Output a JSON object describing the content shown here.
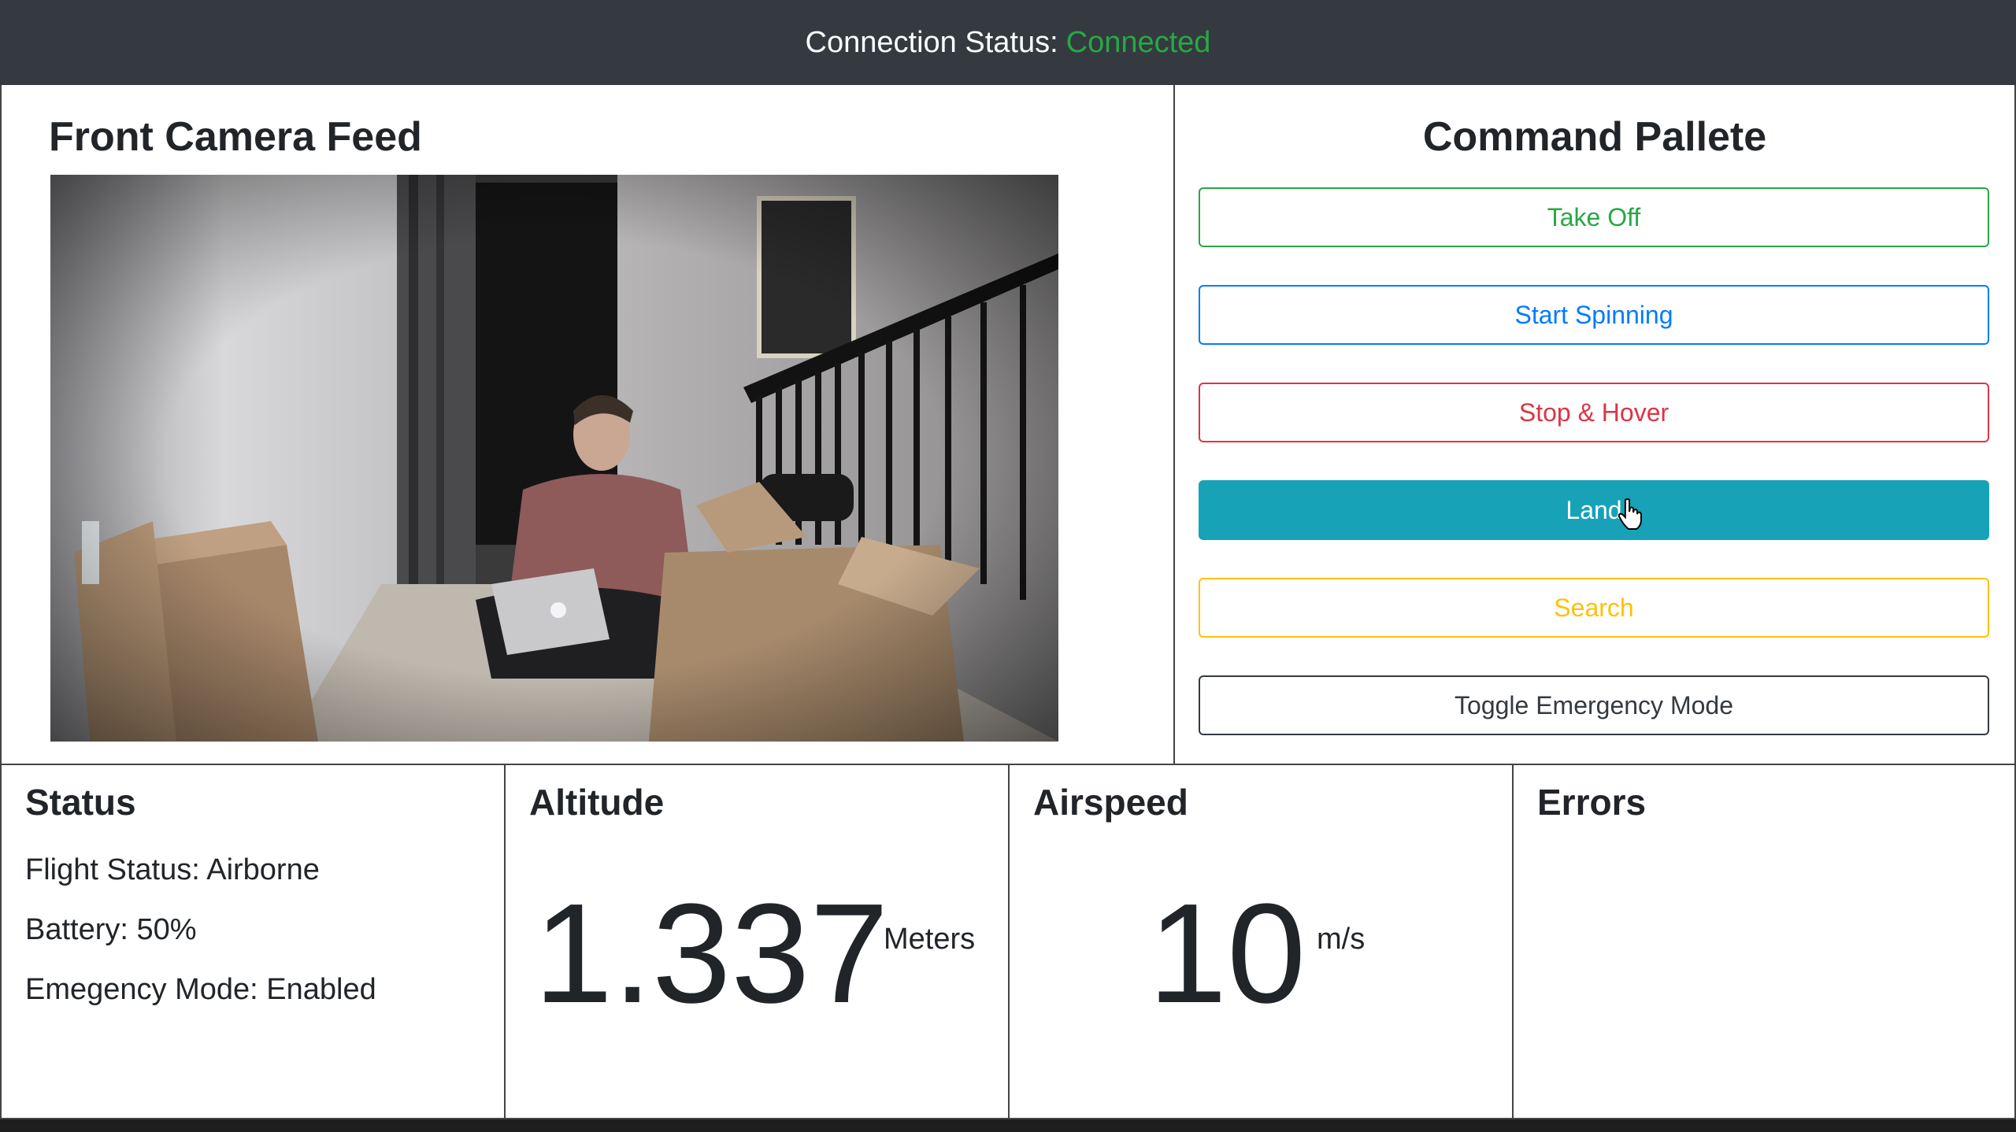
{
  "header": {
    "label": "Connection Status:",
    "status": "Connected",
    "status_color": "#28a745"
  },
  "camera": {
    "title": "Front Camera Feed"
  },
  "commands": {
    "title": "Command Pallete",
    "buttons": [
      {
        "label": "Take Off",
        "variant": "outline-success"
      },
      {
        "label": "Start Spinning",
        "variant": "outline-primary"
      },
      {
        "label": "Stop & Hover",
        "variant": "outline-danger"
      },
      {
        "label": "Land",
        "variant": "info"
      },
      {
        "label": "Search",
        "variant": "outline-warning"
      },
      {
        "label": "Toggle Emergency Mode",
        "variant": "outline-dark"
      }
    ]
  },
  "status": {
    "title": "Status",
    "flight_status": "Flight Status: Airborne",
    "battery": "Battery: 50%",
    "emergency": "Emegency Mode: Enabled"
  },
  "altitude": {
    "title": "Altitude",
    "value": "1.337",
    "unit": "Meters"
  },
  "airspeed": {
    "title": "Airspeed",
    "value": "10",
    "unit": "m/s"
  },
  "errors": {
    "title": "Errors"
  }
}
